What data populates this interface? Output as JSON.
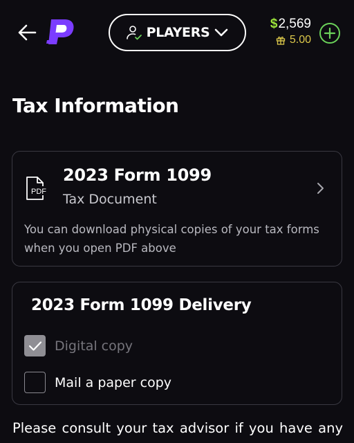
{
  "header": {
    "back_icon": "arrow-left-icon",
    "logo_icon": "brand-p-logo-icon",
    "players_icon": "user-check-icon",
    "players_label": "PLAYERS",
    "players_chevron": "chevron-down-icon",
    "balance_symbol": "$",
    "balance_amount": "2,569",
    "bonus_icon": "gift-icon",
    "bonus_amount": "5.00",
    "add_icon": "plus-circle-icon"
  },
  "page": {
    "title": "Tax Information"
  },
  "document_card": {
    "icon": "pdf-file-icon",
    "title": "2023 Form 1099",
    "subtitle": "Tax Document",
    "description": "You can download physical copies of your tax forms when you open PDF above",
    "chevron_icon": "chevron-right-icon"
  },
  "delivery_card": {
    "title": "2023 Form 1099 Delivery",
    "options": [
      {
        "label": "Digital copy",
        "checked": true,
        "disabled": true
      },
      {
        "label": "Mail a paper copy",
        "checked": false,
        "disabled": false
      }
    ]
  },
  "footer": {
    "text": "Please consult your tax advisor if you have any"
  },
  "colors": {
    "background": "#0d0c11",
    "brand_purple": "#7b3cff",
    "money_green": "#9be33a",
    "bonus_gold": "#dcc84a",
    "add_green": "#6bd35a",
    "card_border": "#3a3942"
  }
}
